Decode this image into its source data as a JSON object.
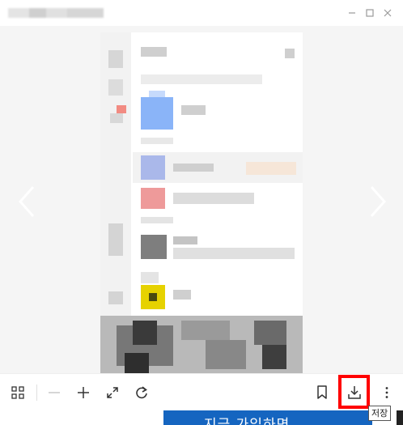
{
  "window": {
    "controls": [
      "minimize",
      "maximize",
      "close"
    ]
  },
  "viewer": {
    "icons": {
      "prev": "chevron-left-icon",
      "next": "chevron-right-icon"
    }
  },
  "toolbar": {
    "buttons": [
      "grid-icon",
      "zoom-out-icon",
      "zoom-in-icon",
      "expand-icon",
      "rotate-icon",
      "bookmark-icon",
      "download-icon",
      "more-icon"
    ],
    "save_tooltip": "저장",
    "highlight_color": "#ff0000"
  },
  "banner": {
    "text": "지금 가입하면",
    "color": "#1565c0"
  }
}
